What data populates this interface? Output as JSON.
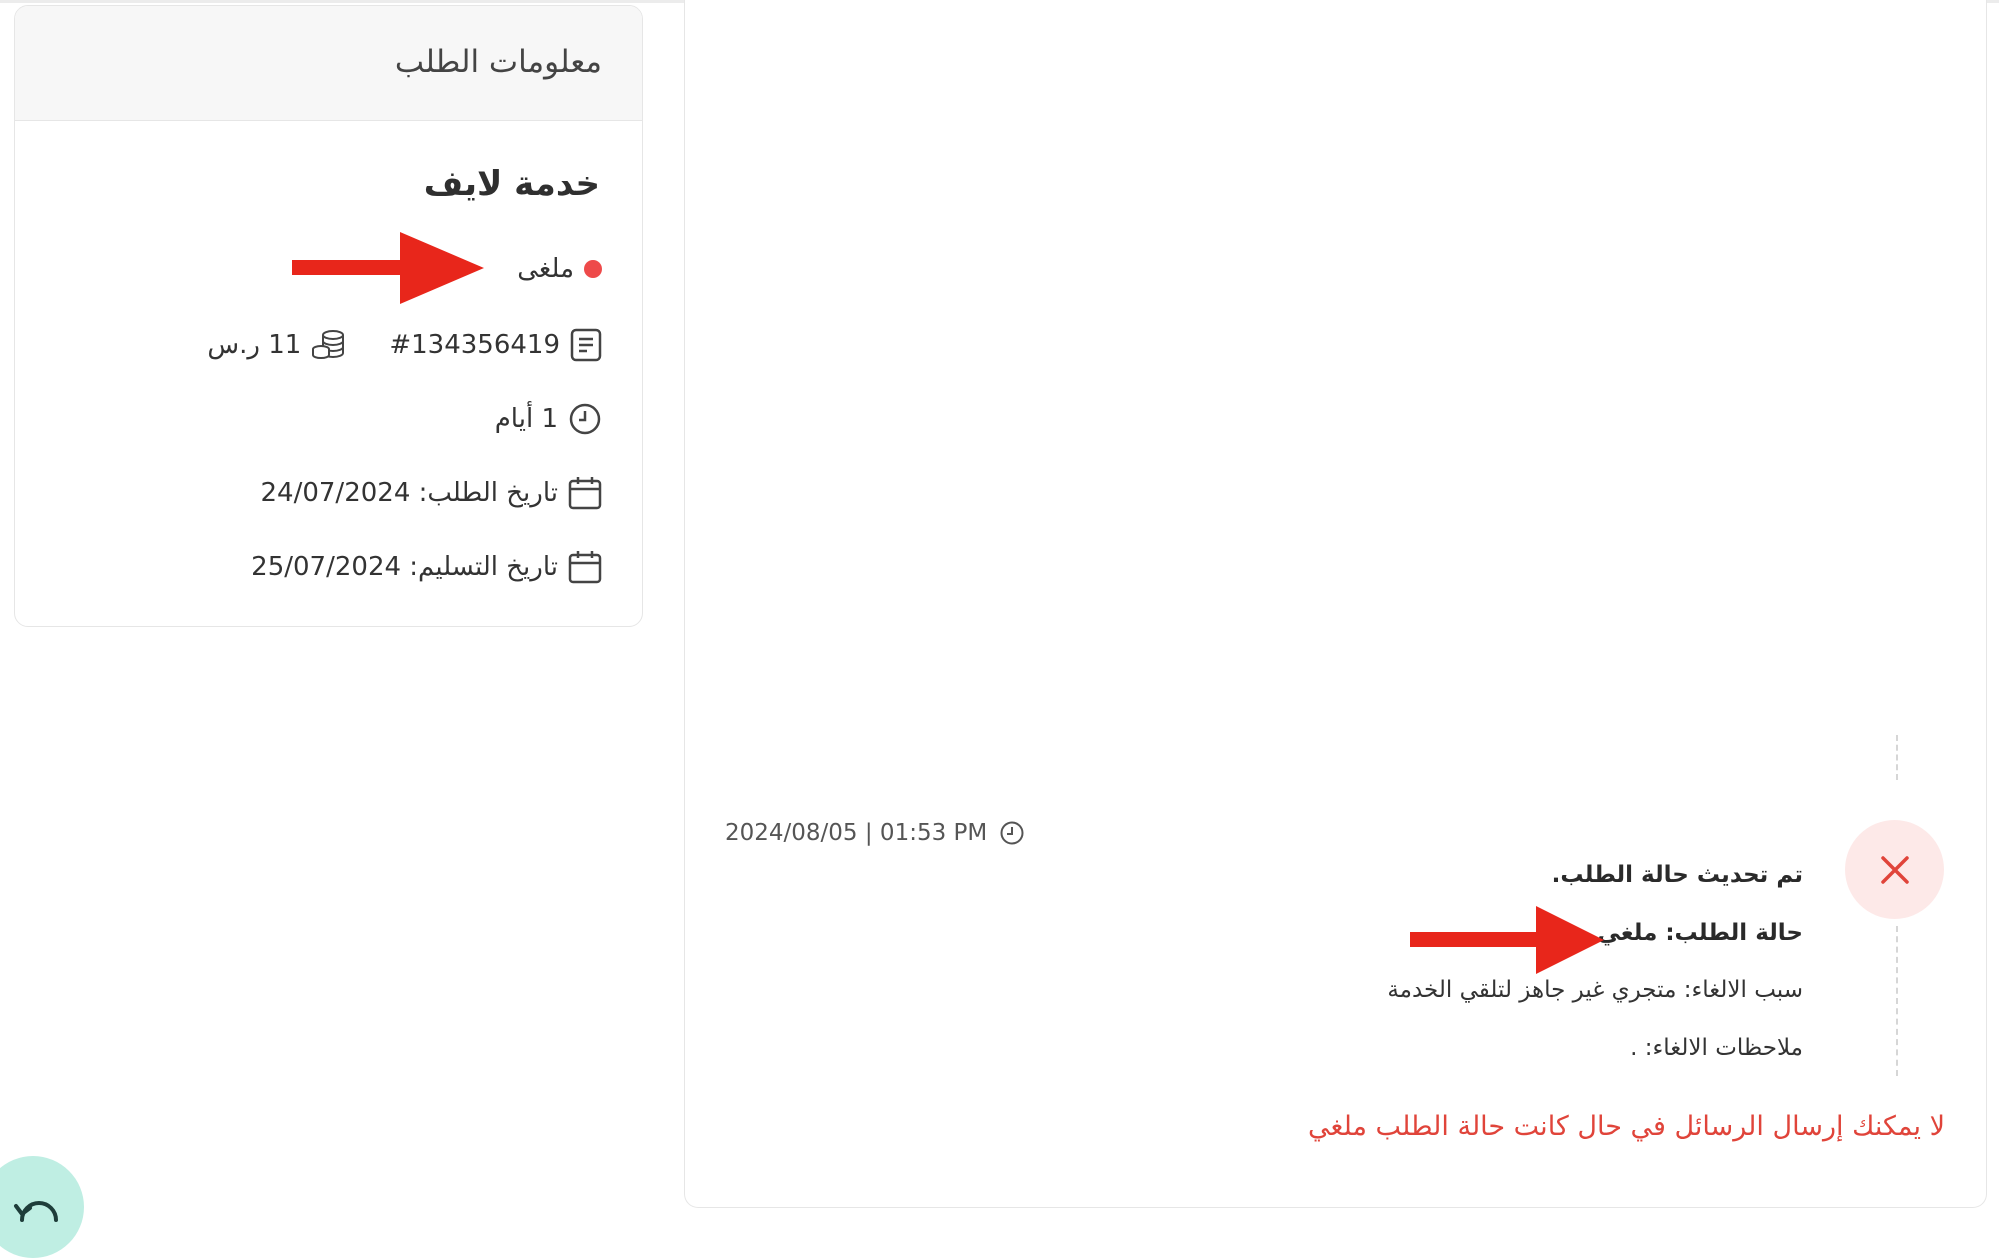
{
  "order_info": {
    "title": "معلومات الطلب",
    "service_name": "خدمة لايف",
    "status": "ملغى",
    "order_number": "#134356419",
    "price": "11 ر.س",
    "duration": "1 أيام",
    "order_date": "تاريخ الطلب: 24/07/2024",
    "delivery_date": "تاريخ التسليم: 25/07/2024"
  },
  "timeline": {
    "timestamp": "2024/08/05 | 01:53 PM",
    "update_title": "تم تحديث حالة الطلب.",
    "status_line": "حالة الطلب: ملغي",
    "reason_line": "سبب الالغاء: متجري غير جاهز لتلقي الخدمة",
    "notes_line": "ملاحظات الالغاء: ."
  },
  "warning": "لا يمكنك إرسال الرسائل في حال كانت حالة الطلب ملغي",
  "colors": {
    "accent_red": "#e0443a",
    "status_dot": "#ee4a4a",
    "arrow_red": "#e8261b",
    "cancel_bg": "#fde9e8",
    "refresh_bg": "#bfeee3"
  },
  "icons": {
    "receipt": "receipt-icon",
    "coins": "coins-icon",
    "clock": "clock-icon",
    "calendar": "calendar-icon",
    "close": "close-icon",
    "refresh": "refresh-icon"
  }
}
